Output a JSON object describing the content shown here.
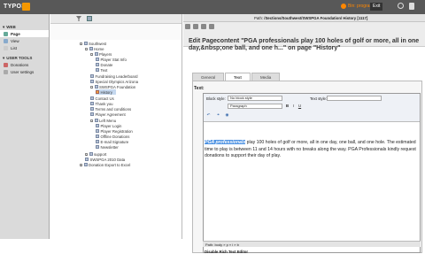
{
  "topbar": {
    "logo": "TYPO3",
    "user": "Bin: programmer",
    "exit": "Exit"
  },
  "module_menu": {
    "groups": [
      {
        "title": "WEB",
        "items": [
          "Page",
          "View",
          "List"
        ]
      },
      {
        "title": "USER TOOLS",
        "items": [
          "Donations",
          "User settings"
        ]
      }
    ]
  },
  "tree": {
    "nodes": [
      "Southwest",
      "Home",
      "Players",
      "Player Stat Info",
      "Donate",
      "Text",
      "Fundraising Leaderboard",
      "Special Olympics Arizona",
      "SWSPGA Foundation",
      "History",
      "Contact Us",
      "Thank you",
      "Terms and conditions",
      "Player Agreement",
      "Left Menu",
      "Player Login",
      "Player Registration",
      "Offline Donations",
      "E-mail Signature",
      "Newsletter",
      "support",
      "SWSPGA 2010 Data",
      "Donation Export to Excel"
    ]
  },
  "content": {
    "path_label": "Path:",
    "path_value": "/Sections/Southwest/SWSPGA Foundation/",
    "path_current": "History [1117]",
    "title": "Edit Pagecontent \"PGA professionals play 100 holes of golf or more, all in one day,&nbsp;one ball, and one h...\" on page \"History\"",
    "tabs": [
      "General",
      "Text",
      "Media"
    ],
    "active_tab": "Text",
    "text_label": "Text:",
    "block_style_label": "Block style:",
    "block_style_value": "No block style",
    "text_style_label": "Text style:",
    "paragraph_value": "Paragraph",
    "body_highlight": "PGA professionals",
    "body_rest": " play 100 holes of golf or more, all in one day, one ball, and one hole. The estimated time to play is between 11 and 14 hours with no breaks along the way.  PGA Professionals kindly request donations to support their day of play.",
    "status_path": "Path:   body » p » i » b",
    "disable_rte": "Disable Rich Text Editor"
  }
}
